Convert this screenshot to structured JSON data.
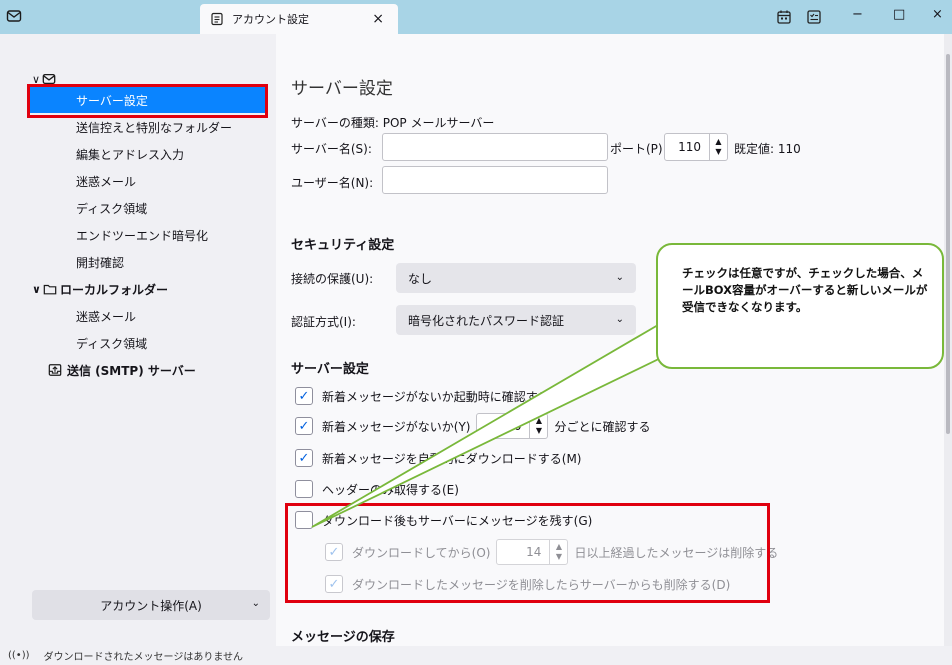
{
  "window": {
    "tab_label": "アカウント設定",
    "tab_close": "×",
    "calendar_icon": "calendar-icon",
    "tasks_icon": "tasks-icon",
    "minimize": "−",
    "maximize": "□",
    "close": "×"
  },
  "sidebar": {
    "account_items": [
      "サーバー設定",
      "送信控えと特別なフォルダー",
      "編集とアドレス入力",
      "迷惑メール",
      "ディスク領域",
      "エンドツーエンド暗号化",
      "開封確認"
    ],
    "local_folders": "ローカルフォルダー",
    "local_items": [
      "迷惑メール",
      "ディスク領域"
    ],
    "smtp": "送信 (SMTP) サーバー",
    "account_ops": "アカウント操作(A)"
  },
  "main": {
    "title": "サーバー設定",
    "server_type": "サーバーの種類: POP メールサーバー",
    "server_name_label": "サーバー名(S):",
    "server_name_value": "",
    "port_label": "ポート(P):",
    "port_value": "110",
    "default_label": "既定値: 110",
    "user_name_label": "ユーザー名(N):",
    "user_name_value": "",
    "security_heading": "セキュリティ設定",
    "conn_security_label": "接続の保護(U):",
    "conn_security_value": "なし",
    "auth_label": "認証方式(I):",
    "auth_value": "暗号化されたパスワード認証",
    "server_settings_heading": "サーバー設定",
    "check_startup": "新着メッセージがないか起動時に確認する(C)",
    "check_every_pre": "新着メッセージがないか(Y)",
    "check_every_value": "10",
    "check_every_post": "分ごとに確認する",
    "auto_download": "新着メッセージを自動的にダウンロードする(M)",
    "headers_only": "ヘッダーのみ取得する(E)",
    "leave_on_server": "ダウンロード後もサーバーにメッセージを残す(G)",
    "delete_after_pre": "ダウンロードしてから(O)",
    "delete_after_value": "14",
    "delete_after_post": "日以上経過したメッセージは削除する",
    "delete_sync": "ダウンロードしたメッセージを削除したらサーバーからも削除する(D)",
    "message_storage_heading": "メッセージの保存"
  },
  "callout": {
    "text": "チェックは任意ですが、チェックした場合、メールBOX容量がオーバーすると新しいメールが受信できなくなります。"
  },
  "status": {
    "text": "ダウンロードされたメッセージはありません"
  },
  "colors": {
    "titlebar": "#a8d4e6",
    "selection": "#0a84ff",
    "highlight_box": "#e0000f",
    "callout_border": "#79b83a"
  }
}
